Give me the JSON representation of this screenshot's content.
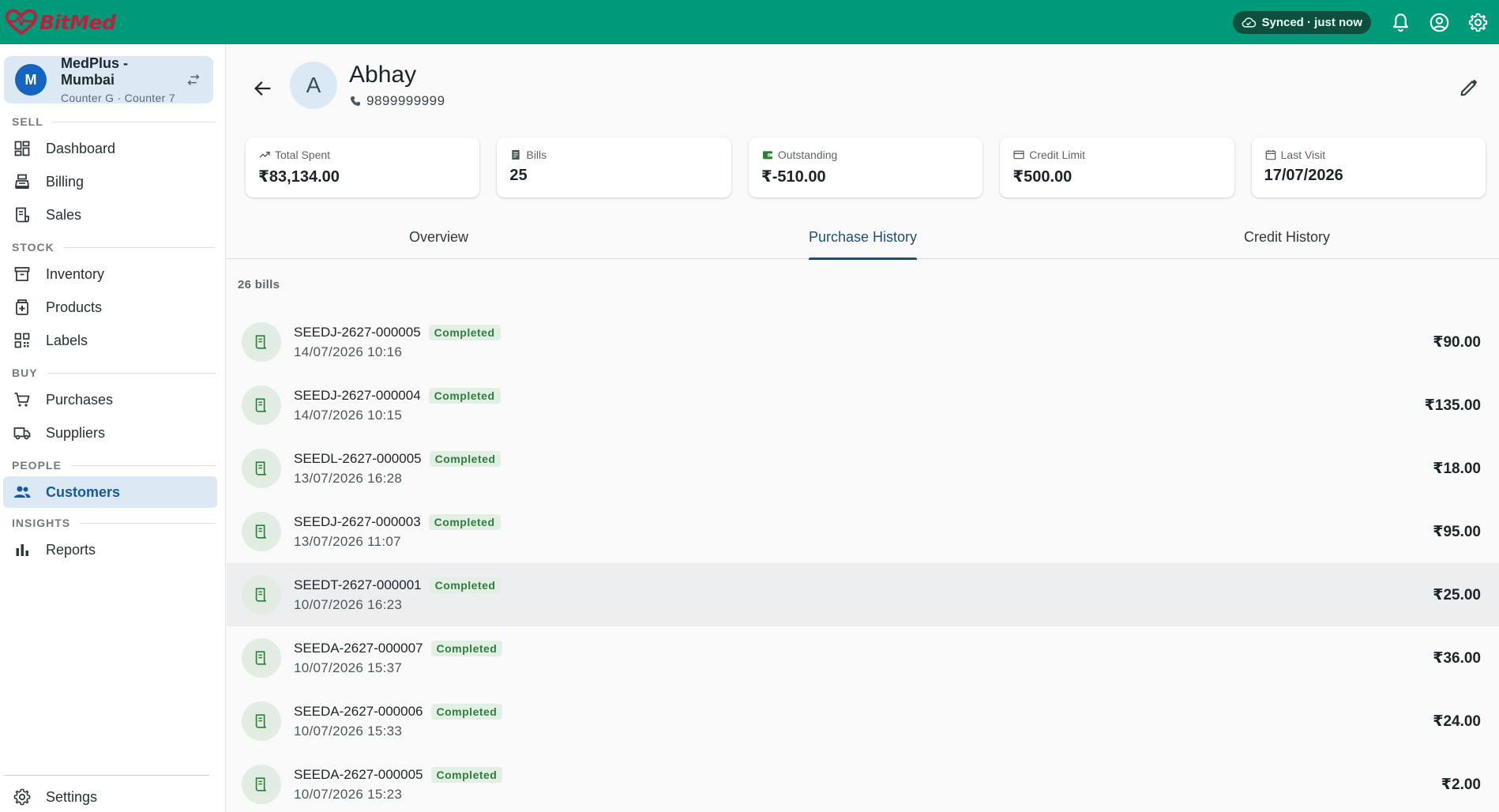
{
  "app": {
    "logo_text": "BitMed"
  },
  "topbar": {
    "sync_label": "Synced · just now",
    "icons": [
      "cloud-done-icon",
      "bell-icon",
      "account-circle-icon",
      "gear-icon"
    ]
  },
  "store": {
    "avatar": "M",
    "name": "MedPlus - Mumbai",
    "sub": "Counter G · Counter 7"
  },
  "nav": {
    "sections": {
      "sell": "SELL",
      "stock": "STOCK",
      "buy": "BUY",
      "people": "PEOPLE",
      "insights": "INSIGHTS"
    },
    "items": {
      "dashboard": "Dashboard",
      "billing": "Billing",
      "sales": "Sales",
      "inventory": "Inventory",
      "products": "Products",
      "labels": "Labels",
      "purchases": "Purchases",
      "suppliers": "Suppliers",
      "customers": "Customers",
      "reports": "Reports",
      "settings": "Settings"
    },
    "active": "customers"
  },
  "customer": {
    "avatar": "A",
    "name": "Abhay",
    "phone": "9899999999"
  },
  "stats": [
    {
      "label": "Total Spent",
      "value": "₹83,134.00",
      "icon": "trending-up-icon"
    },
    {
      "label": "Bills",
      "value": "25",
      "icon": "receipt-icon"
    },
    {
      "label": "Outstanding",
      "value": "₹-510.00",
      "icon": "wallet-icon"
    },
    {
      "label": "Credit Limit",
      "value": "₹500.00",
      "icon": "credit-card-icon"
    },
    {
      "label": "Last Visit",
      "value": "17/07/2026",
      "icon": "calendar-icon"
    }
  ],
  "tabs": [
    {
      "label": "Overview"
    },
    {
      "label": "Purchase History"
    },
    {
      "label": "Credit History"
    }
  ],
  "active_tab": "Purchase History",
  "bill_count": "26 bills",
  "status_color": "#2f7d3b",
  "accent_color": "#00997a",
  "bills": [
    {
      "no": "SEEDJ-2627-000005",
      "status": "Completed",
      "date": "14/07/2026 10:16",
      "amount": "₹90.00"
    },
    {
      "no": "SEEDJ-2627-000004",
      "status": "Completed",
      "date": "14/07/2026 10:15",
      "amount": "₹135.00"
    },
    {
      "no": "SEEDL-2627-000005",
      "status": "Completed",
      "date": "13/07/2026 16:28",
      "amount": "₹18.00"
    },
    {
      "no": "SEEDJ-2627-000003",
      "status": "Completed",
      "date": "13/07/2026 11:07",
      "amount": "₹95.00"
    },
    {
      "no": "SEEDT-2627-000001",
      "status": "Completed",
      "date": "10/07/2026 16:23",
      "amount": "₹25.00"
    },
    {
      "no": "SEEDA-2627-000007",
      "status": "Completed",
      "date": "10/07/2026 15:37",
      "amount": "₹36.00"
    },
    {
      "no": "SEEDA-2627-000006",
      "status": "Completed",
      "date": "10/07/2026 15:33",
      "amount": "₹24.00"
    },
    {
      "no": "SEEDA-2627-000005",
      "status": "Completed",
      "date": "10/07/2026 15:23",
      "amount": "₹2.00"
    }
  ]
}
